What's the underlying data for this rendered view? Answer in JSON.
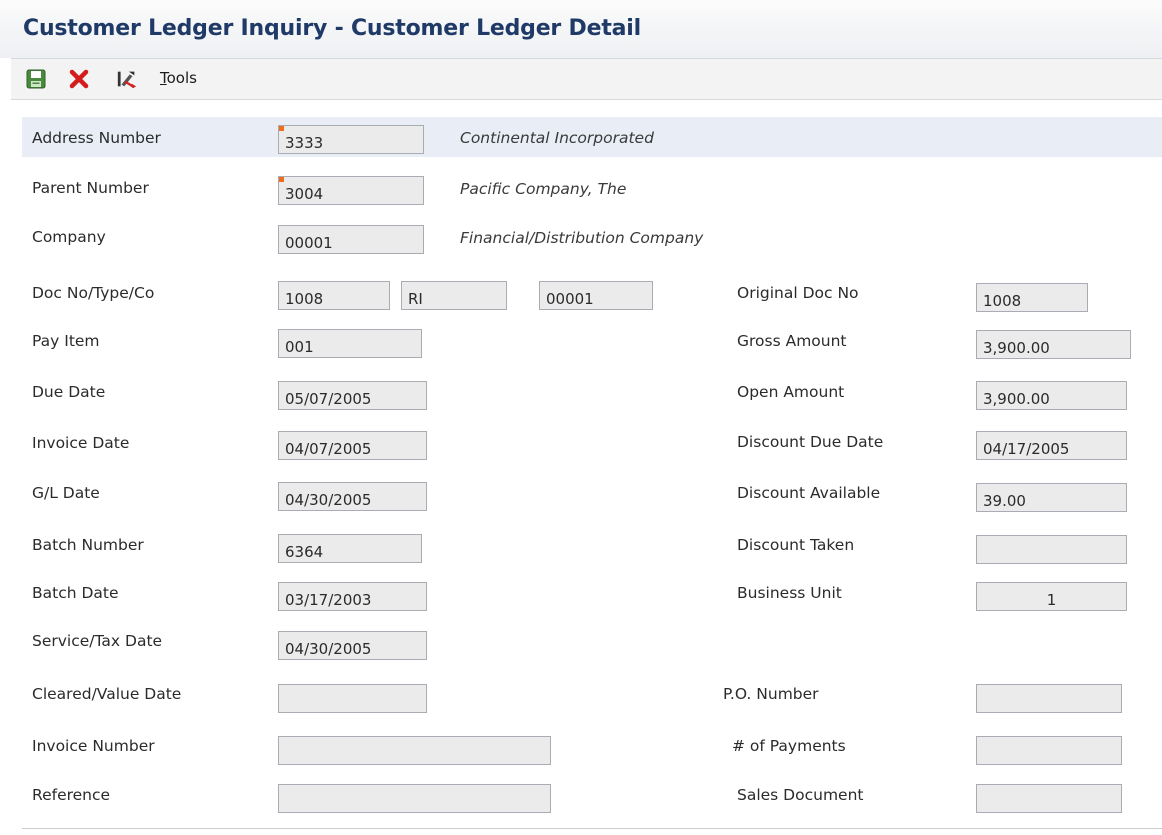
{
  "window": {
    "title": "Customer Ledger Inquiry - Customer Ledger Detail"
  },
  "toolbar": {
    "ok_icon": "save-disk-icon",
    "cancel_icon": "red-x-icon",
    "tools_icon": "tools-icon",
    "tools_first": "T",
    "tools_rest": "ools"
  },
  "header": {
    "address_number": {
      "label": "Address Number",
      "value": "3333",
      "description": "Continental Incorporated"
    },
    "parent_number": {
      "label": "Parent Number",
      "value": "3004",
      "description": "Pacific Company, The"
    },
    "company": {
      "label": "Company",
      "value": "00001",
      "description": "Financial/Distribution Company"
    }
  },
  "left": {
    "doc": {
      "label": "Doc No/Type/Co",
      "doc_no": "1008",
      "doc_type": "RI",
      "doc_co": "00001"
    },
    "pay_item": {
      "label": "Pay Item",
      "value": "001"
    },
    "due_date": {
      "label": "Due Date",
      "value": "05/07/2005"
    },
    "invoice_date": {
      "label": "Invoice Date",
      "value": "04/07/2005"
    },
    "gl_date": {
      "label": "G/L Date",
      "value": "04/30/2005"
    },
    "batch_number": {
      "label": "Batch Number",
      "value": "6364"
    },
    "batch_date": {
      "label": "Batch Date",
      "value": "03/17/2003"
    },
    "service_tax_date": {
      "label": "Service/Tax Date",
      "value": "04/30/2005"
    },
    "cleared_value_date": {
      "label": "Cleared/Value Date",
      "value": ""
    },
    "invoice_number": {
      "label": "Invoice Number",
      "value": ""
    },
    "reference": {
      "label": "Reference",
      "value": ""
    }
  },
  "right": {
    "original_doc_no": {
      "label": "Original Doc No",
      "value": "1008"
    },
    "gross_amount": {
      "label": "Gross Amount",
      "value": "3,900.00"
    },
    "open_amount": {
      "label": "Open Amount",
      "value": "3,900.00"
    },
    "discount_due_date": {
      "label": "Discount Due Date",
      "value": "04/17/2005"
    },
    "discount_available": {
      "label": "Discount Available",
      "value": "39.00"
    },
    "discount_taken": {
      "label": "Discount Taken",
      "value": ""
    },
    "business_unit": {
      "label": "Business Unit",
      "value": "1"
    },
    "po_number": {
      "label": "P.O. Number",
      "value": ""
    },
    "num_payments": {
      "label": "# of Payments",
      "value": ""
    },
    "sales_document": {
      "label": "Sales Document",
      "value": ""
    }
  },
  "colors": {
    "title": "#1f3a66",
    "field_bg": "#ebebeb",
    "field_border": "#a9adb3",
    "required_marker": "#f06d1e",
    "band": "#e9eef6"
  }
}
